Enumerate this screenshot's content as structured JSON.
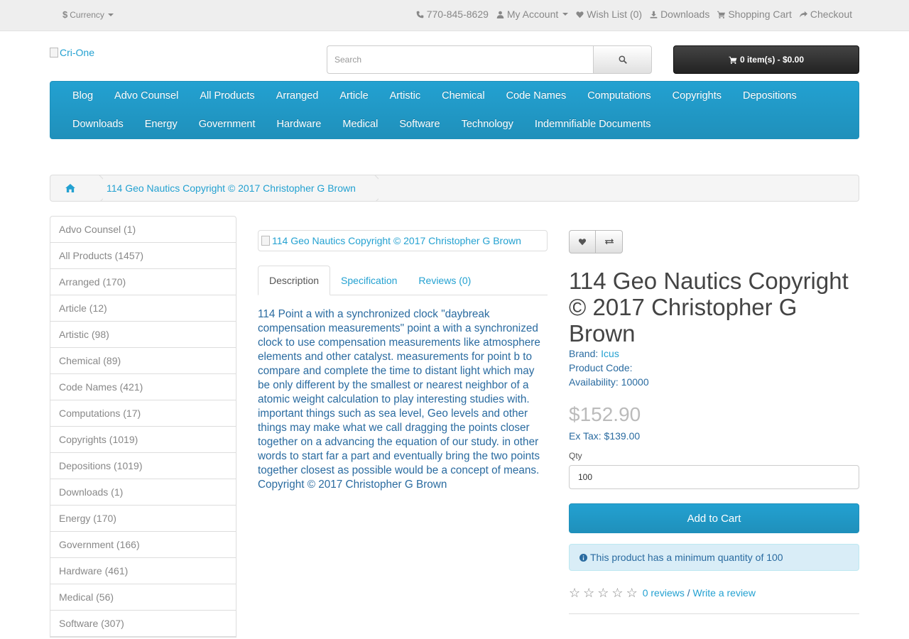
{
  "topbar": {
    "currency_label": "Currency",
    "currency_symbol": "$",
    "phone": "770-845-8629",
    "my_account": "My Account",
    "wishlist": "Wish List (0)",
    "downloads": "Downloads",
    "shopping_cart": "Shopping Cart",
    "checkout": "Checkout"
  },
  "header": {
    "logo_alt": "Cri-One",
    "search_placeholder": "Search",
    "cart_label": "0 item(s) - $0.00"
  },
  "menu": {
    "row1": [
      "Blog",
      "Advo Counsel",
      "All Products",
      "Arranged",
      "Article",
      "Artistic",
      "Chemical",
      "Code Names",
      "Computations",
      "Copyrights",
      "Depositions"
    ],
    "row2": [
      "Downloads",
      "Energy",
      "Government",
      "Hardware",
      "Medical",
      "Software",
      "Technology",
      "Indemnifiable Documents"
    ]
  },
  "breadcrumb": {
    "current": "114 Geo Nautics Copyright © 2017 Christopher G Brown"
  },
  "sidebar": {
    "categories": [
      "Advo Counsel (1)",
      "All Products (1457)",
      "Arranged (170)",
      "Article (12)",
      "Artistic (98)",
      "Chemical (89)",
      "Code Names (421)",
      "Computations (17)",
      "Copyrights (1019)",
      "Depositions (1019)",
      "Downloads (1)",
      "Energy (170)",
      "Government (166)",
      "Hardware (461)",
      "Medical (56)",
      "Software (307)"
    ]
  },
  "product": {
    "image_alt": "114 Geo Nautics Copyright © 2017 Christopher G Brown",
    "tabs": [
      "Description",
      "Specification",
      "Reviews (0)"
    ],
    "description": "114 Point a with a synchronized clock \"daybreak compensation measurements\"  point a with a synchronized clock to use compensation measurements like atmosphere elements and other catalyst. measurements for point b to compare and complete the time to distant light which may be only different by the smallest or nearest neighbor of a atomic weight calculation to play interesting studies with. important things such as sea level, Geo levels and other things may make what we call dragging the points closer together on a advancing the equation of our study. in other words to start far a part and eventually bring the two points together closest as possible would be a concept of means. Copyright © 2017 Christopher G Brown",
    "title": "114 Geo Nautics Copyright © 2017 Christopher G Brown",
    "brand_label": "Brand:",
    "brand": "Icus",
    "product_code_label": "Product Code:",
    "availability_label": "Availability:",
    "availability": "10000",
    "price": "$152.90",
    "ex_tax": "Ex Tax: $139.00",
    "qty_label": "Qty",
    "qty_value": "100",
    "add_to_cart": "Add to Cart",
    "min_qty_alert": "This product has a minimum quantity of 100",
    "rating_stars": 0,
    "reviews_link": "0 reviews",
    "review_sep": "/",
    "write_review": "Write a review"
  }
}
